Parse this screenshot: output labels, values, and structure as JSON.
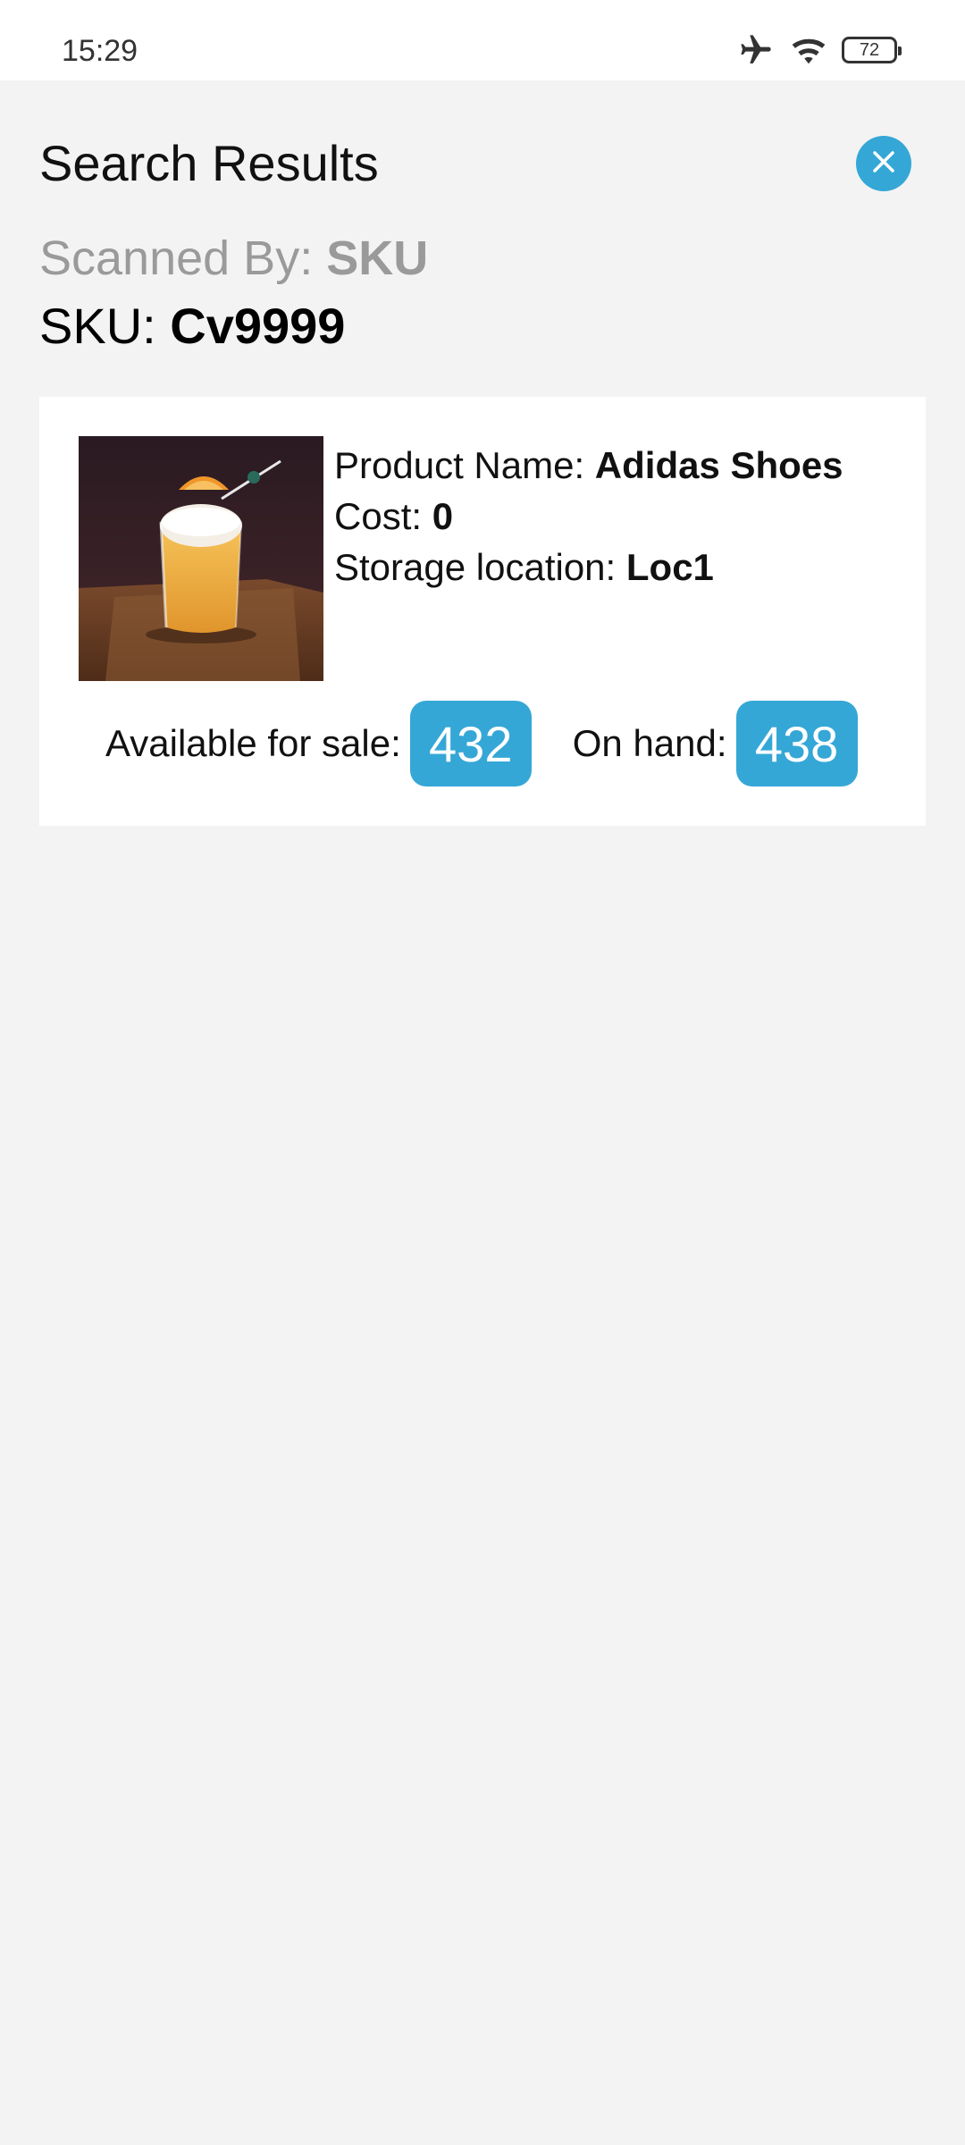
{
  "status_bar": {
    "time": "15:29",
    "battery": "72",
    "icons": [
      "airplane-icon",
      "wifi-icon",
      "battery-icon"
    ]
  },
  "header": {
    "title": "Search Results",
    "close_icon": "close-icon"
  },
  "scan": {
    "scanned_by_label": "Scanned By:",
    "scanned_by_value": "SKU",
    "sku_label": "SKU:",
    "sku_value": "Cv9999"
  },
  "product": {
    "name_label": "Product Name:",
    "name_value": "Adidas Shoes",
    "cost_label": "Cost:",
    "cost_value": "0",
    "location_label": "Storage location:",
    "location_value": "Loc1",
    "available_label": "Available for sale:",
    "available_value": "432",
    "on_hand_label": "On hand:",
    "on_hand_value": "438"
  },
  "colors": {
    "accent": "#35a7d6",
    "background": "#f3f3f3",
    "card": "#ffffff"
  }
}
